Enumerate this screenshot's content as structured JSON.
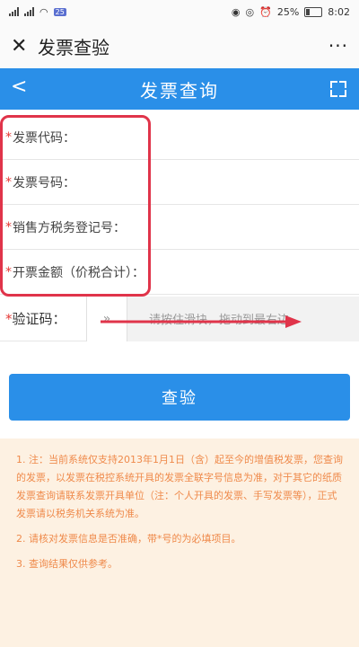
{
  "status_bar": {
    "badge": "25",
    "battery_percent": "25%",
    "time": "8:02"
  },
  "app_header": {
    "close_icon": "close-icon",
    "title": "发票查验",
    "more_icon": "more-dots-icon",
    "more_glyph": "···"
  },
  "nav_bar": {
    "back_glyph": "<",
    "title": "发票查询",
    "expand_icon": "fullscreen-icon",
    "color": "#2a8fe8"
  },
  "form": {
    "required_mark": "*",
    "fields": [
      {
        "label": "发票代码：",
        "value": ""
      },
      {
        "label": "发票号码：",
        "value": ""
      },
      {
        "label": "销售方税务登记号：",
        "value": ""
      },
      {
        "label": "开票金额（价税合计）：",
        "value": ""
      }
    ],
    "captcha": {
      "label": "验证码：",
      "slider_handle": "»",
      "slider_hint": "请按住滑块，拖动到最右边"
    }
  },
  "submit_label": "查验",
  "notice": {
    "items": [
      "1. 注：当前系统仅支持2013年1月1日（含）起至今的增值税发票，您查询的发票，以发票在税控系统开具的发票全联字号信息为准，对于其它的纸质发票查询请联系发票开具单位（注：个人开具的发票、手写发票等），正式发票请以税务机关系统为准。",
      "2. 请核对发票信息是否准确，带*号的为必填项目。",
      "3. 查询结果仅供参考。"
    ],
    "color": "#ef8a4b"
  }
}
